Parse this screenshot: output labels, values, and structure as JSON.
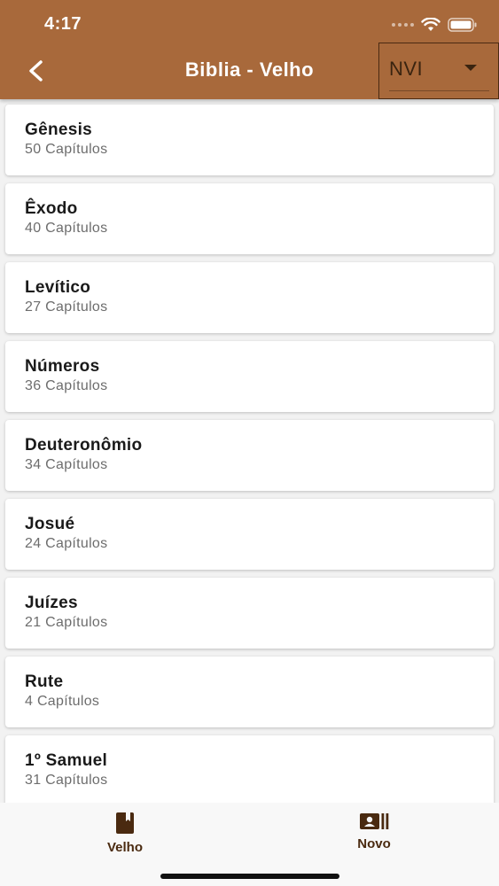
{
  "status_bar": {
    "time": "4:17"
  },
  "header": {
    "title": "Biblia - Velho",
    "version_select": {
      "value": "NVI"
    }
  },
  "books": [
    {
      "name": "Gênesis",
      "chapters": "50 Capítulos"
    },
    {
      "name": "Êxodo",
      "chapters": "40 Capítulos"
    },
    {
      "name": "Levítico",
      "chapters": "27 Capítulos"
    },
    {
      "name": "Números",
      "chapters": "36 Capítulos"
    },
    {
      "name": "Deuteronômio",
      "chapters": "34 Capítulos"
    },
    {
      "name": "Josué",
      "chapters": "24 Capítulos"
    },
    {
      "name": "Juízes",
      "chapters": "21 Capítulos"
    },
    {
      "name": "Rute",
      "chapters": "4 Capítulos"
    },
    {
      "name": "1º Samuel",
      "chapters": "31 Capítulos"
    }
  ],
  "tabs": [
    {
      "label": "Velho",
      "icon": "book-icon",
      "active": true
    },
    {
      "label": "Novo",
      "icon": "contacts-book-icon",
      "active": false
    }
  ],
  "colors": {
    "header": "#a8693b",
    "tab_active": "#4a2a10"
  }
}
